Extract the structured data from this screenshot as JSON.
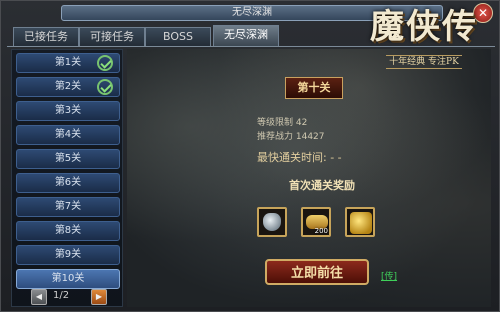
{
  "window": {
    "title": "无尽深渊",
    "close": "✕"
  },
  "tabs": [
    "已接任务",
    "可接任务",
    "BOSS",
    "无尽深渊"
  ],
  "levels": [
    {
      "label": "第1关",
      "done": true
    },
    {
      "label": "第2关",
      "done": true
    },
    {
      "label": "第3关",
      "done": false
    },
    {
      "label": "第4关",
      "done": false
    },
    {
      "label": "第5关",
      "done": false
    },
    {
      "label": "第6关",
      "done": false
    },
    {
      "label": "第7关",
      "done": false
    },
    {
      "label": "第8关",
      "done": false
    },
    {
      "label": "第9关",
      "done": false
    },
    {
      "label": "第10关",
      "done": false
    }
  ],
  "pager": {
    "text": "1/2"
  },
  "logo": {
    "main": "魔侠传",
    "sub": "十年经典 专注PK"
  },
  "stage": {
    "name": "第十关",
    "level_limit": "等级限制  42",
    "power": "推荐战力  14427",
    "fastest": "最快通关时间: - -"
  },
  "reward": {
    "title": "首次通关奖励",
    "items": [
      {
        "icon": "wolf-mount-icon",
        "qty": ""
      },
      {
        "icon": "scroll-icon",
        "qty": "200"
      },
      {
        "icon": "gold-ingot-icon",
        "qty": ""
      }
    ]
  },
  "buttons": {
    "go": "立即前往",
    "tip": "[传]"
  }
}
